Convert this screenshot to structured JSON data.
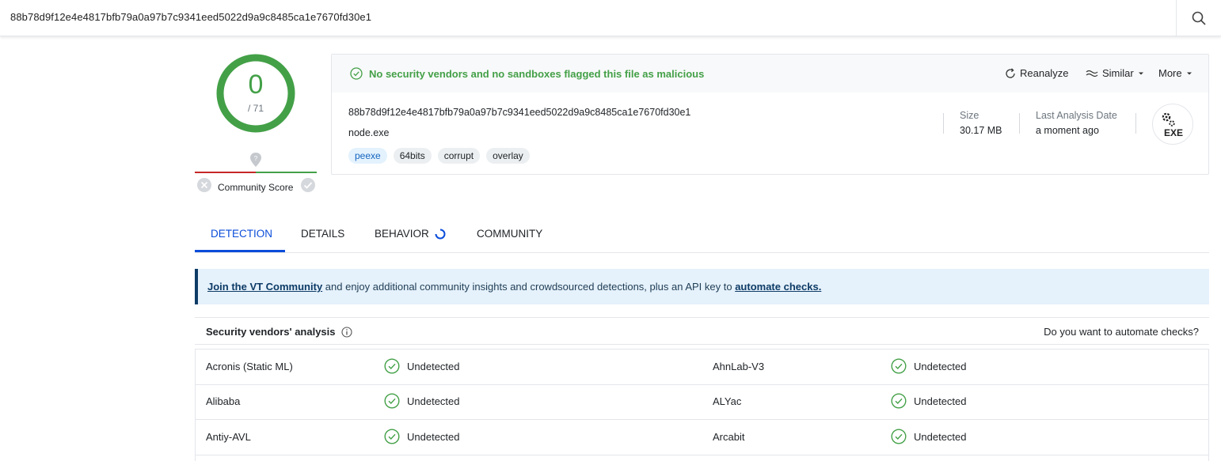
{
  "search": {
    "query": "88b78d9f12e4e4817bfb79a0a97b7c9341eed5022d9a9c8485ca1e7670fd30e1"
  },
  "score": {
    "detections": "0",
    "total": "/ 71",
    "community_label": "Community Score"
  },
  "summary": {
    "status": "No security vendors and no sandboxes flagged this file as malicious",
    "actions": {
      "reanalyze": "Reanalyze",
      "similar": "Similar",
      "more": "More"
    },
    "hash": "88b78d9f12e4e4817bfb79a0a97b7c9341eed5022d9a9c8485ca1e7670fd30e1",
    "filename": "node.exe",
    "tags": [
      "peexe",
      "64bits",
      "corrupt",
      "overlay"
    ],
    "size_label": "Size",
    "size_value": "30.17 MB",
    "date_label": "Last Analysis Date",
    "date_value": "a moment ago",
    "file_type": "EXE"
  },
  "tabs": [
    "DETECTION",
    "DETAILS",
    "BEHAVIOR",
    "COMMUNITY"
  ],
  "banner": {
    "link1": "Join the VT Community",
    "middle": " and enjoy additional community insights and crowdsourced detections, plus an API key to ",
    "link2": "automate checks."
  },
  "vendors": {
    "title": "Security vendors' analysis",
    "automate": "Do you want to automate checks?",
    "rows": [
      {
        "left_name": "Acronis (Static ML)",
        "left_result": "Undetected",
        "right_name": "AhnLab-V3",
        "right_result": "Undetected"
      },
      {
        "left_name": "Alibaba",
        "left_result": "Undetected",
        "right_name": "ALYac",
        "right_result": "Undetected"
      },
      {
        "left_name": "Antiy-AVL",
        "left_result": "Undetected",
        "right_name": "Arcabit",
        "right_result": "Undetected"
      }
    ]
  },
  "colors": {
    "clean": "#43a047",
    "accent": "#0b4dda",
    "banner_bg": "#e5f1fb"
  }
}
